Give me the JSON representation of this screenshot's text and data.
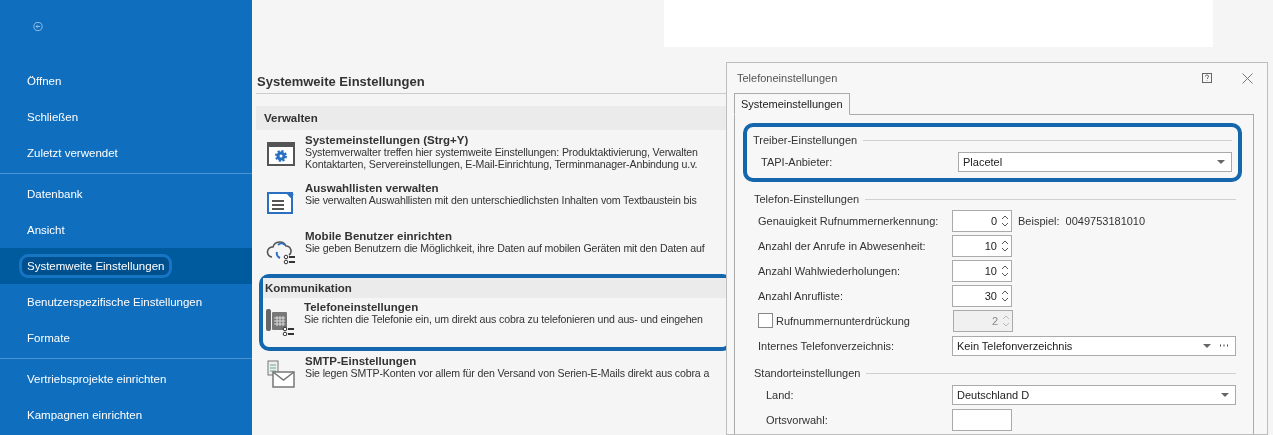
{
  "sidebar": {
    "groups": [
      [
        {
          "label": "Öffnen",
          "selected": false
        },
        {
          "label": "Schließen",
          "selected": false
        },
        {
          "label": "Zuletzt verwendet",
          "selected": false
        }
      ],
      [
        {
          "label": "Datenbank",
          "selected": false
        },
        {
          "label": "Ansicht",
          "selected": false
        },
        {
          "label": "Systemweite Einstellungen",
          "selected": true
        },
        {
          "label": "Benutzerspezifische Einstellungen",
          "selected": false
        },
        {
          "label": "Formate",
          "selected": false
        }
      ],
      [
        {
          "label": "Vertriebsprojekte einrichten",
          "selected": false
        },
        {
          "label": "Kampagnen einrichten",
          "selected": false
        }
      ]
    ]
  },
  "main": {
    "title": "Systemweite Einstellungen",
    "sections": [
      {
        "title": "Verwalten",
        "highlighted": false,
        "items": [
          {
            "title": "Systemeinstellungen (Strg+Y)",
            "lines": [
              "Systemverwalter treffen hier systemweite Einstellungen: Produktaktivierung, Verwalten",
              "Kontaktarten, Servereinstellungen, E-Mail-Einrichtung, Terminmanager-Anbindung u.v."
            ]
          },
          {
            "title": "Auswahllisten verwalten",
            "lines": [
              "Sie verwalten Auswahllisten mit den unterschiedlichsten Inhalten vom Textbaustein bis"
            ]
          },
          {
            "title": "Mobile Benutzer einrichten",
            "lines": [
              "Sie geben Benutzern die Möglichkeit, ihre Daten auf mobilen Geräten mit den Daten auf"
            ]
          }
        ]
      },
      {
        "title": "Kommunikation",
        "highlighted": true,
        "items": [
          {
            "title": "Telefoneinstellungen",
            "lines": [
              "Sie richten die Telefonie ein, um direkt aus cobra zu telefonieren und aus- und eingehen"
            ]
          }
        ]
      },
      {
        "highlighted": false,
        "items": [
          {
            "title": "SMTP-Einstellungen",
            "lines": [
              "Sie legen SMTP-Konten vor allem für den Versand von Serien-E-Mails direkt aus cobra a"
            ]
          }
        ]
      }
    ]
  },
  "dialog": {
    "title": "Telefoneinstellungen",
    "tabs": [
      {
        "label": "Systemeinstellungen",
        "selected": true
      }
    ],
    "groups": [
      {
        "title": "Treiber-Einstellungen",
        "highlighted": true,
        "rows": [
          {
            "kind": "combo",
            "label": "TAPI-Anbieter:",
            "value": "Placetel"
          }
        ]
      },
      {
        "title": "Telefon-Einstellungen",
        "highlighted": false,
        "rows": [
          {
            "kind": "spin",
            "label": "Genauigkeit Rufnummernerkennung:",
            "value": "0",
            "hint": "Beispiel:",
            "hint_value": "0049753181010"
          },
          {
            "kind": "spin",
            "label": "Anzahl der Anrufe in Abwesenheit:",
            "value": "10"
          },
          {
            "kind": "spin",
            "label": "Anzahl Wahlwiederholungen:",
            "value": "10"
          },
          {
            "kind": "spin",
            "label": "Anzahl Anrufliste:",
            "value": "30"
          },
          {
            "kind": "check-spin",
            "label": "Rufnummernunterdrückung",
            "checked": false,
            "disabled": true,
            "value": "2"
          },
          {
            "kind": "combo-more",
            "label": "Internes Telefonverzeichnis:",
            "value": "Kein Telefonverzeichnis"
          }
        ]
      },
      {
        "title": "Standorteinstellungen",
        "highlighted": false,
        "rows": [
          {
            "kind": "combo",
            "label": "Land:",
            "value": "Deutschland D"
          },
          {
            "kind": "text",
            "label": "Ortsvorwahl:"
          }
        ]
      }
    ]
  }
}
